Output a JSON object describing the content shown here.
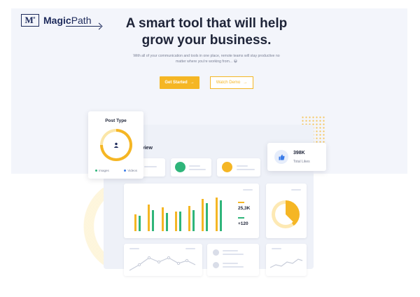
{
  "brand": {
    "name_bold": "Magic",
    "name_rest": "Path",
    "mark": "M"
  },
  "hero": {
    "headline_line1": "A smart tool that will help",
    "headline_line2": "grow your business.",
    "subtext_line1": "With all of your communication and tools in one place, remote teams will stay productive no",
    "subtext_line2": "matter where you're working from... 😀",
    "primary_button": "Get Started",
    "secondary_button": "Watch Demo",
    "button_arrow": "→"
  },
  "dashboard": {
    "title": "rview",
    "post_type": {
      "title": "Post Type",
      "legend": [
        {
          "label": "Images",
          "color": "#2fb57a"
        },
        {
          "label": "Videos",
          "color": "#3a7be8"
        }
      ]
    },
    "likes": {
      "count": "398K",
      "label": "Total Likes"
    },
    "metrics": [
      {
        "value": "25,3K",
        "color": "#f5b624"
      },
      {
        "value": "+120",
        "color": "#2fb57a"
      }
    ]
  },
  "colors": {
    "accent": "#f5b624",
    "green": "#2fb57a",
    "navy": "#1e2b5c",
    "blue": "#3a7be8"
  }
}
